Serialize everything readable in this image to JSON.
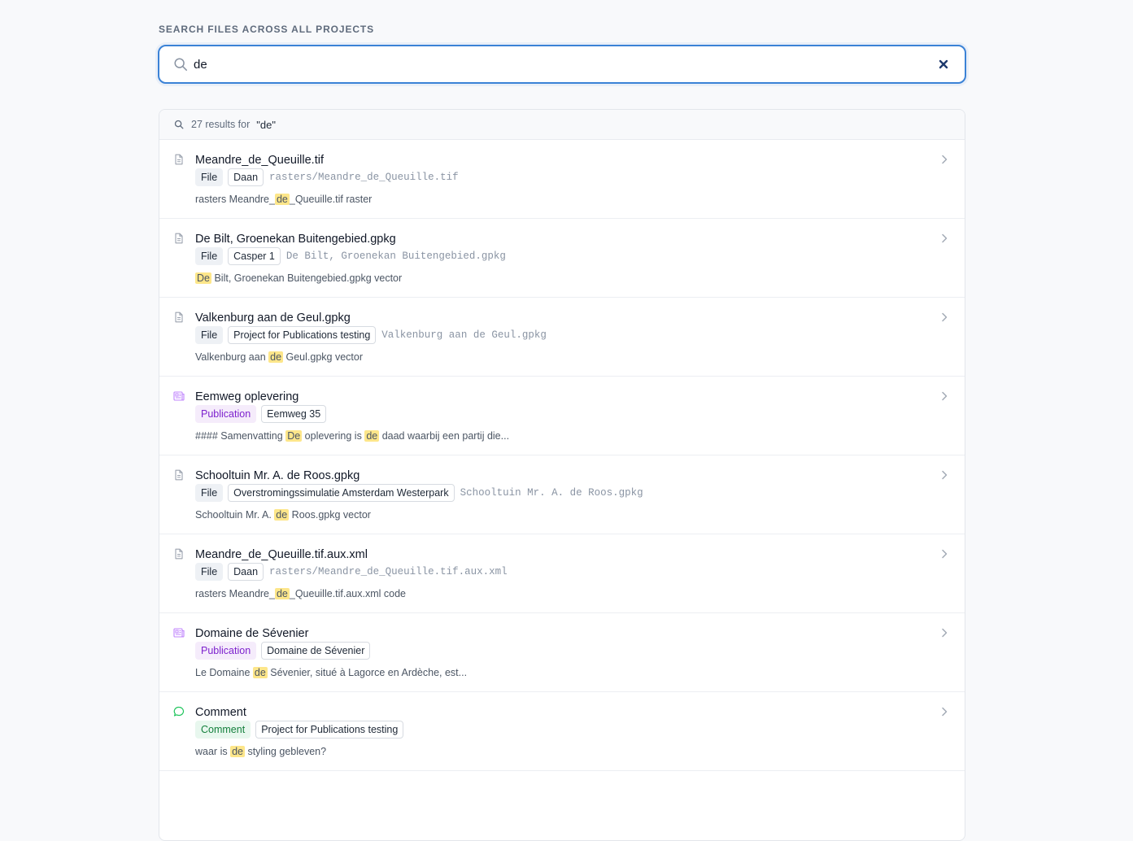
{
  "search": {
    "label": "SEARCH FILES ACROSS ALL PROJECTS",
    "value": "de"
  },
  "results_header": {
    "count_text": "27 results for",
    "query": "\"de\""
  },
  "colors": {
    "accent": "#3b82d6",
    "highlight": "#fde68a",
    "publication": "#7e22ce",
    "comment": "#15803d"
  },
  "results": [
    {
      "icon": "file-icon",
      "title": "Meandre_de_Queuille.tif",
      "type_badge": "File",
      "project": "Daan",
      "path": "rasters/Meandre_de_Queuille.tif",
      "snippet_pre": "rasters Meandre_",
      "snippet_match": "de",
      "snippet_post": "_Queuille.tif raster"
    },
    {
      "icon": "file-icon",
      "title": "De Bilt, Groenekan Buitengebied.gpkg",
      "type_badge": "File",
      "project": "Casper 1",
      "path": "De Bilt, Groenekan Buitengebied.gpkg",
      "snippet_pre": "",
      "snippet_match": "De",
      "snippet_post": " Bilt, Groenekan Buitengebied.gpkg vector"
    },
    {
      "icon": "file-icon",
      "title": "Valkenburg aan de Geul.gpkg",
      "type_badge": "File",
      "project": "Project for Publications testing",
      "path": "Valkenburg aan de Geul.gpkg",
      "snippet_pre": "Valkenburg aan ",
      "snippet_match": "de",
      "snippet_post": " Geul.gpkg vector"
    },
    {
      "icon": "publication-icon",
      "title": "Eemweg oplevering",
      "type_badge": "Publication",
      "project": "Eemweg 35",
      "path": "",
      "snippet_pre": "#### Samenvatting ",
      "snippet_match": "De",
      "snippet_mid": " oplevering is ",
      "snippet_match2": "de",
      "snippet_post": " daad waarbij een partij die..."
    },
    {
      "icon": "file-icon",
      "title": "Schooltuin Mr. A. de Roos.gpkg",
      "type_badge": "File",
      "project": "Overstromingssimulatie Amsterdam Westerpark",
      "path": "Schooltuin Mr. A. de Roos.gpkg",
      "snippet_pre": "Schooltuin Mr. A. ",
      "snippet_match": "de",
      "snippet_post": " Roos.gpkg vector"
    },
    {
      "icon": "file-icon",
      "title": "Meandre_de_Queuille.tif.aux.xml",
      "type_badge": "File",
      "project": "Daan",
      "path": "rasters/Meandre_de_Queuille.tif.aux.xml",
      "snippet_pre": "rasters Meandre_",
      "snippet_match": "de",
      "snippet_post": "_Queuille.tif.aux.xml code"
    },
    {
      "icon": "publication-icon",
      "title": "Domaine de Sévenier",
      "type_badge": "Publication",
      "project": "Domaine de Sévenier",
      "path": "",
      "snippet_pre": "Le Domaine ",
      "snippet_match": "de",
      "snippet_post": " Sévenier, situé à Lagorce en Ardèche, est..."
    },
    {
      "icon": "comment-icon",
      "title": "Comment",
      "type_badge": "Comment",
      "project": "Project for Publications testing",
      "path": "",
      "snippet_pre": "waar is ",
      "snippet_match": "de",
      "snippet_post": " styling gebleven?"
    }
  ]
}
